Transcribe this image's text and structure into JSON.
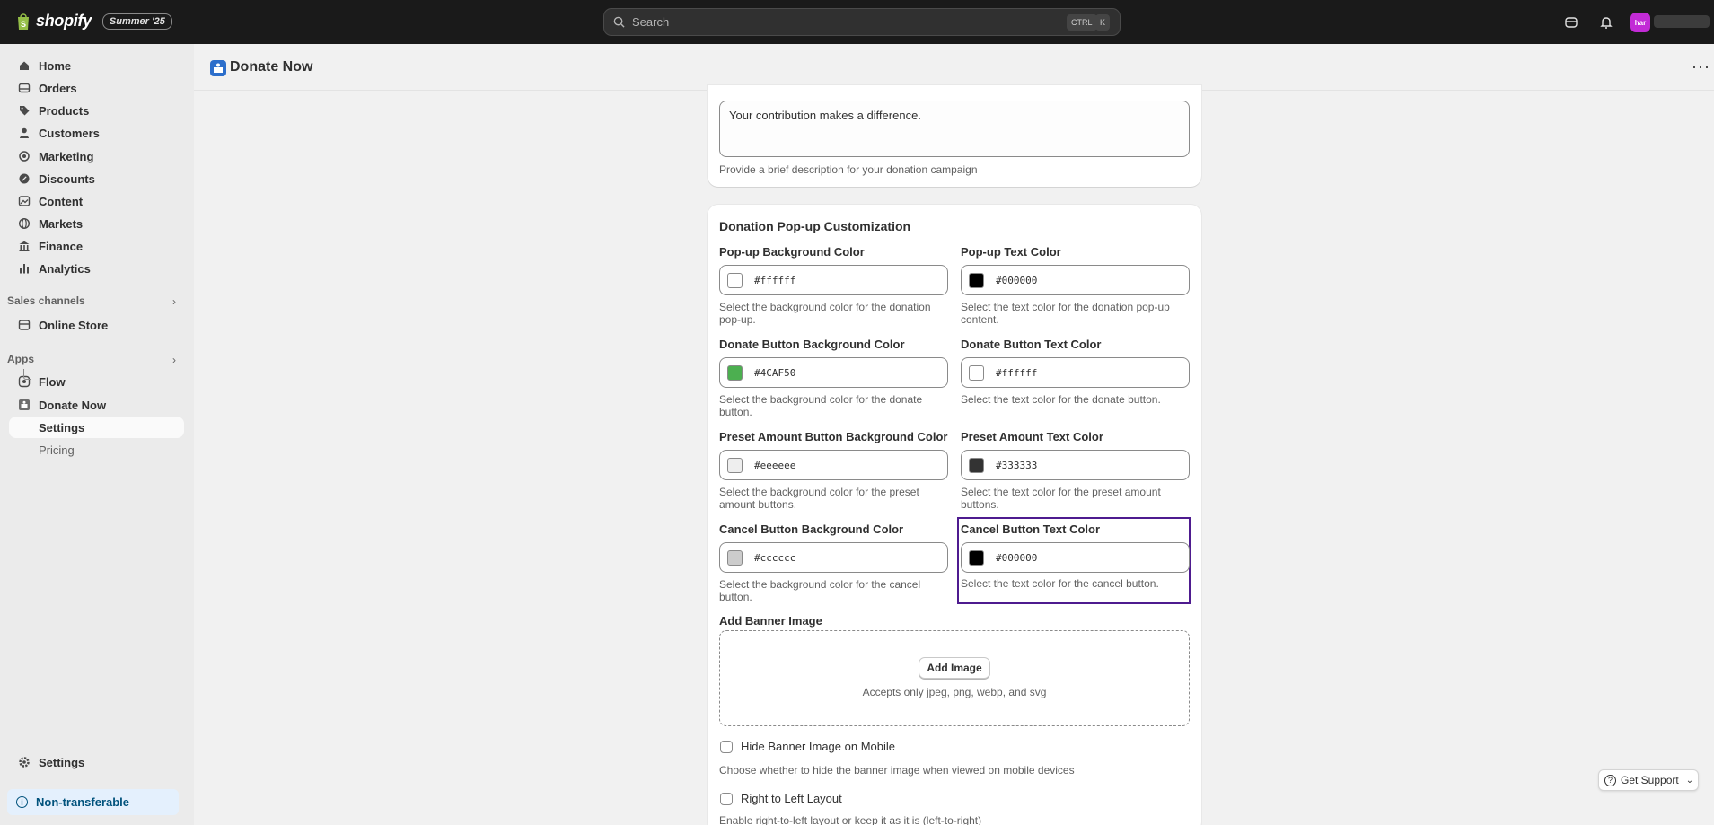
{
  "topbar": {
    "brand": "shopify",
    "edition_badge": "Summer '25",
    "search_placeholder": "Search",
    "kbd_ctrl": "CTRL",
    "kbd_k": "K",
    "avatar_initials": "har"
  },
  "sidebar": {
    "items": [
      {
        "label": "Home",
        "icon": "home-icon"
      },
      {
        "label": "Orders",
        "icon": "orders-icon"
      },
      {
        "label": "Products",
        "icon": "tag-icon"
      },
      {
        "label": "Customers",
        "icon": "person-icon"
      },
      {
        "label": "Marketing",
        "icon": "target-icon"
      },
      {
        "label": "Discounts",
        "icon": "discount-icon"
      },
      {
        "label": "Content",
        "icon": "content-icon"
      },
      {
        "label": "Markets",
        "icon": "globe-icon"
      },
      {
        "label": "Finance",
        "icon": "bank-icon"
      },
      {
        "label": "Analytics",
        "icon": "bar-chart-icon"
      }
    ],
    "sales_channels_label": "Sales channels",
    "online_store": "Online Store",
    "apps_label": "Apps",
    "flow": "Flow",
    "donate_now": "Donate Now",
    "app_settings": "Settings",
    "pricing": "Pricing",
    "settings": "Settings",
    "non_transferable": "Non-transferable"
  },
  "page": {
    "title": "Donate Now",
    "description_value": "Your contribution makes a difference.",
    "description_help": "Provide a brief description for your donation campaign",
    "customization_title": "Donation Pop-up Customization",
    "fields": {
      "popup_bg": {
        "label": "Pop-up Background Color",
        "value": "#ffffff",
        "help": "Select the background color for the donation pop-up.",
        "swatch": "#ffffff"
      },
      "popup_text": {
        "label": "Pop-up Text Color",
        "value": "#000000",
        "help": "Select the text color for the donation pop-up content.",
        "swatch": "#000000"
      },
      "donate_bg": {
        "label": "Donate Button Background Color",
        "value": "#4CAF50",
        "help": "Select the background color for the donate button.",
        "swatch": "#4CAF50"
      },
      "donate_text": {
        "label": "Donate Button Text Color",
        "value": "#ffffff",
        "help": "Select the text color for the donate button.",
        "swatch": "#ffffff"
      },
      "preset_bg": {
        "label": "Preset Amount Button Background Color",
        "value": "#eeeeee",
        "help": "Select the background color for the preset amount buttons.",
        "swatch": "#eeeeee"
      },
      "preset_text": {
        "label": "Preset Amount Text Color",
        "value": "#333333",
        "help": "Select the text color for the preset amount buttons.",
        "swatch": "#333333"
      },
      "cancel_bg": {
        "label": "Cancel Button Background Color",
        "value": "#cccccc",
        "help": "Select the background color for the cancel button.",
        "swatch": "#cccccc"
      },
      "cancel_text": {
        "label": "Cancel Button Text Color",
        "value": "#000000",
        "help": "Select the text color for the cancel button.",
        "swatch": "#000000"
      }
    },
    "banner_label": "Add Banner Image",
    "add_image_button": "Add Image",
    "accepts_text": "Accepts only jpeg, png, webp, and svg",
    "hide_banner_label": "Hide Banner Image on Mobile",
    "hide_banner_help": "Choose whether to hide the banner image when viewed on mobile devices",
    "rtl_label": "Right to Left Layout",
    "rtl_help": "Enable right-to-left layout or keep it as it is (left-to-right)"
  },
  "support_button": "Get Support",
  "colors": {
    "accent_focus": "#4e1b8f",
    "topbar": "#1a1a1a",
    "app_icon": "#2c6ecb"
  }
}
